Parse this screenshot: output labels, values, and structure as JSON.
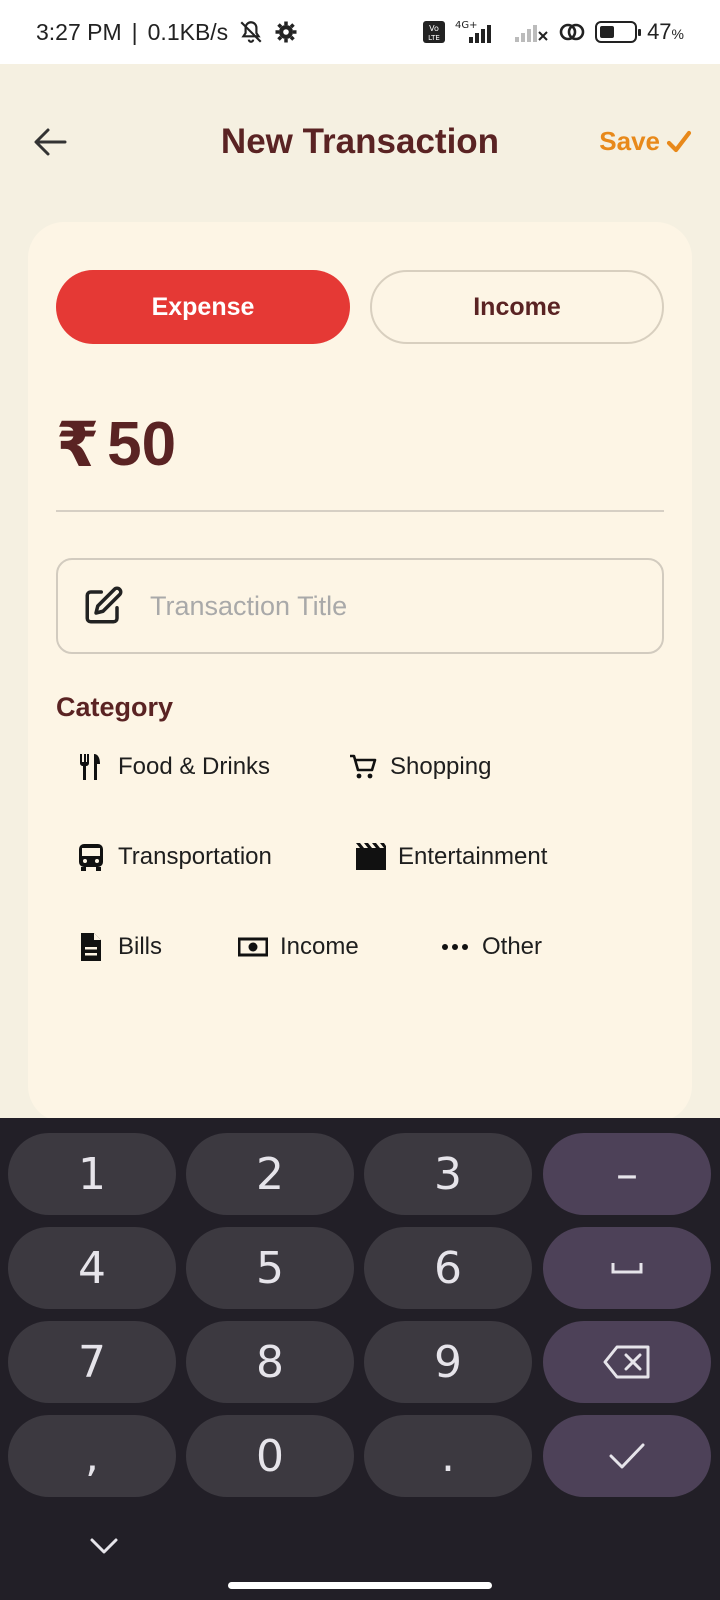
{
  "status_bar": {
    "time": "3:27 PM",
    "separator": "|",
    "speed": "0.1KB/s",
    "network_badge": "4G+",
    "volte_badge": "Vo LTE",
    "battery_level": "47",
    "battery_unit": "%",
    "icons": [
      "mute-icon",
      "settings-icon",
      "volte-icon",
      "signal-icon",
      "signal-off-icon",
      "sync-icon",
      "battery-icon"
    ]
  },
  "header": {
    "title": "New Transaction",
    "save_label": "Save",
    "save_color": "#e8891a"
  },
  "type_toggle": {
    "expense_label": "Expense",
    "income_label": "Income",
    "selected": "Expense",
    "selected_color": "#e53935"
  },
  "amount": {
    "currency_symbol": "₹",
    "value": "50"
  },
  "title_field": {
    "value": "",
    "placeholder": "Transaction Title"
  },
  "category": {
    "label": "Category",
    "items": [
      {
        "label": "Food & Drinks",
        "icon": "fork-knife-icon"
      },
      {
        "label": "Shopping",
        "icon": "cart-icon"
      },
      {
        "label": "Transportation",
        "icon": "bus-icon"
      },
      {
        "label": "Entertainment",
        "icon": "clapperboard-icon"
      },
      {
        "label": "Bills",
        "icon": "document-icon"
      },
      {
        "label": "Income",
        "icon": "cash-icon"
      },
      {
        "label": "Other",
        "icon": "more-dots-icon"
      }
    ]
  },
  "keyboard": {
    "keys": [
      "1",
      "2",
      "3",
      "–",
      "4",
      "5",
      "6",
      "␣",
      "7",
      "8",
      "9",
      "⌫",
      ",",
      "0",
      ".",
      "✓"
    ]
  }
}
